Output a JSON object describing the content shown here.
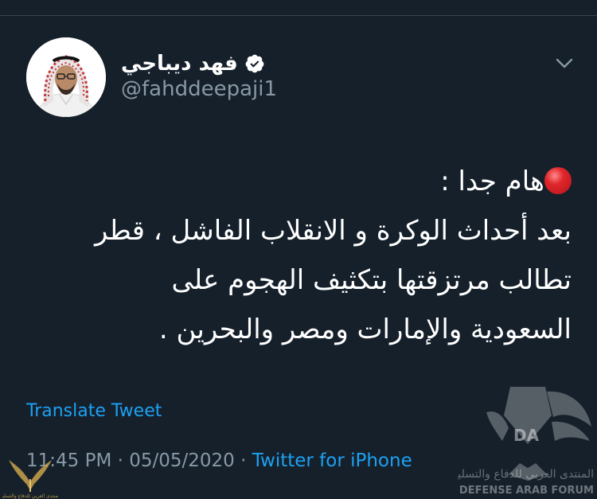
{
  "user": {
    "name": "فهد ديباجي",
    "handle": "@fahddeepaji1",
    "verified": true
  },
  "icons": {
    "avatar": "user-avatar-photo",
    "verified": "verified-badge-icon",
    "menu": "chevron-down-icon",
    "emoji": "red-circle-emoji"
  },
  "tweet": {
    "first_line": "هام جدا :",
    "lines": [
      "بعد أحداث الوكرة و الانقلاب الفاشل ، قطر",
      "تطالب مرتزقتها بتكثيف الهجوم على",
      "السعودية والإمارات ومصر والبحرين ."
    ]
  },
  "translate_label": "Translate Tweet",
  "meta": {
    "time": "11:45 PM",
    "separator": " · ",
    "date": "05/05/2020",
    "source": "Twitter for iPhone"
  },
  "watermark": {
    "arabic": "المنتدى العربي للدفاع والتسليح",
    "english": "DEFENSE ARAB FORUM",
    "logo_letters": "DA"
  },
  "colors": {
    "background": "#15202b",
    "text_primary": "#ffffff",
    "text_secondary": "#8899a6",
    "link": "#1da1f2",
    "verified": "#ffffff"
  }
}
